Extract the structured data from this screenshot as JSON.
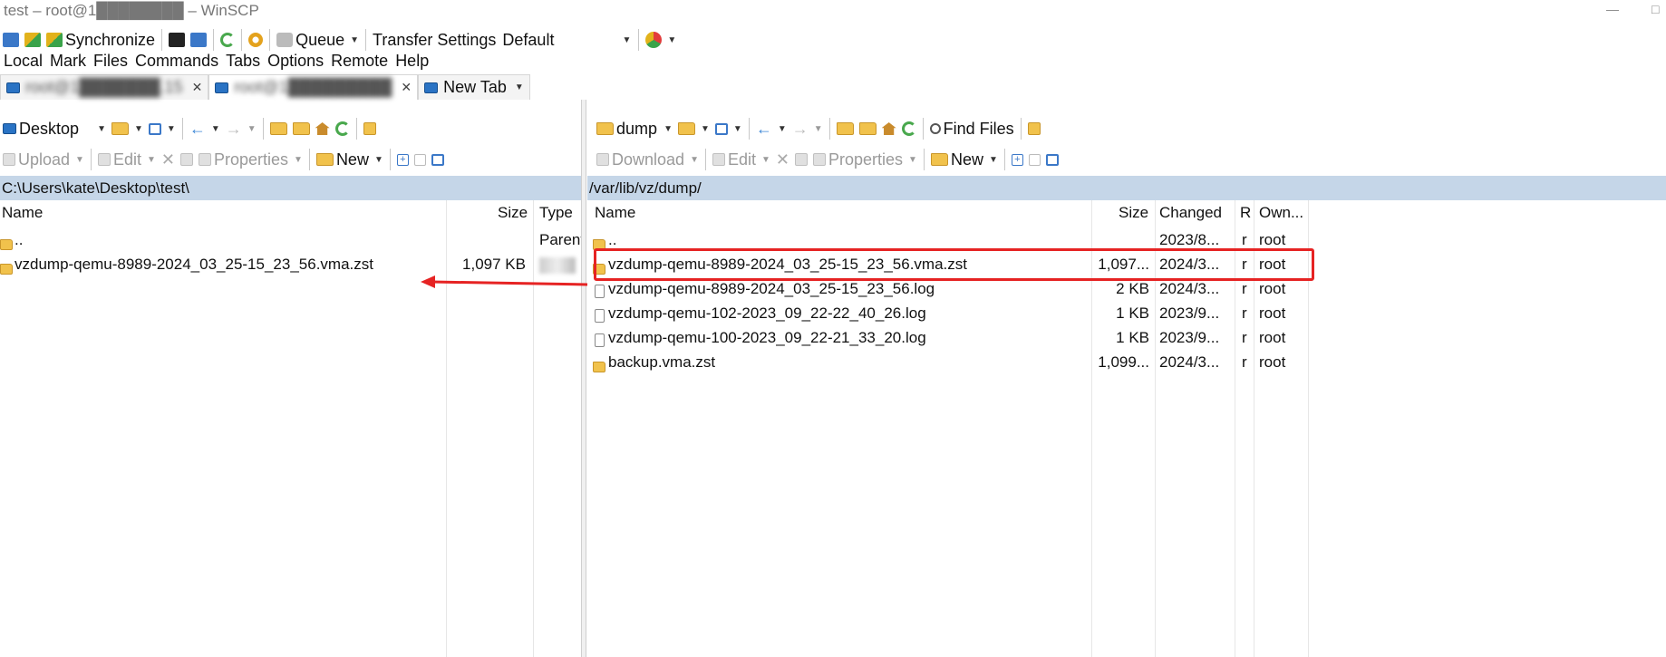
{
  "window": {
    "title": "test – root@1████████ – WinSCP",
    "controls": [
      "—",
      "□"
    ]
  },
  "main_toolbar": {
    "synchronize_label": "Synchronize",
    "queue_label": "Queue",
    "transfer_settings_label": "Transfer Settings",
    "transfer_preset": "Default"
  },
  "menu": [
    "Local",
    "Mark",
    "Files",
    "Commands",
    "Tabs",
    "Options",
    "Remote",
    "Help"
  ],
  "tabs": [
    {
      "label": "root@1███████.15"
    },
    {
      "label": "root@1█████████"
    },
    {
      "label": "New Tab"
    }
  ],
  "local": {
    "location": "Desktop",
    "upload_label": "Upload",
    "edit_label": "Edit",
    "properties_label": "Properties",
    "new_label": "New",
    "path": "C:\\Users\\kate\\Desktop\\test\\",
    "columns": {
      "name": "Name",
      "size": "Size",
      "type": "Type"
    },
    "rows": [
      {
        "name": "..",
        "size": "",
        "type": "Parent"
      },
      {
        "name": "vzdump-qemu-8989-2024_03_25-15_23_56.vma.zst",
        "size": "1,097 KB",
        "type": ""
      }
    ]
  },
  "remote": {
    "location": "dump",
    "find_files_label": "Find Files",
    "download_label": "Download",
    "edit_label": "Edit",
    "properties_label": "Properties",
    "new_label": "New",
    "path": "/var/lib/vz/dump/",
    "columns": {
      "name": "Name",
      "size": "Size",
      "changed": "Changed",
      "rights": "R",
      "owner": "Own..."
    },
    "rows": [
      {
        "icon": "parent",
        "name": "..",
        "size": "",
        "changed": "2023/8...",
        "rights": "r",
        "owner": "root"
      },
      {
        "icon": "archive",
        "name": "vzdump-qemu-8989-2024_03_25-15_23_56.vma.zst",
        "size": "1,097...",
        "changed": "2024/3...",
        "rights": "r",
        "owner": "root"
      },
      {
        "icon": "file",
        "name": "vzdump-qemu-8989-2024_03_25-15_23_56.log",
        "size": "2 KB",
        "changed": "2024/3...",
        "rights": "r",
        "owner": "root"
      },
      {
        "icon": "file",
        "name": "vzdump-qemu-102-2023_09_22-22_40_26.log",
        "size": "1 KB",
        "changed": "2023/9...",
        "rights": "r",
        "owner": "root"
      },
      {
        "icon": "file",
        "name": "vzdump-qemu-100-2023_09_22-21_33_20.log",
        "size": "1 KB",
        "changed": "2023/9...",
        "rights": "r",
        "owner": "root"
      },
      {
        "icon": "archive",
        "name": "backup.vma.zst",
        "size": "1,099...",
        "changed": "2024/3...",
        "rights": "r",
        "owner": "root"
      }
    ]
  },
  "annotation": {
    "color": "#e62323"
  }
}
